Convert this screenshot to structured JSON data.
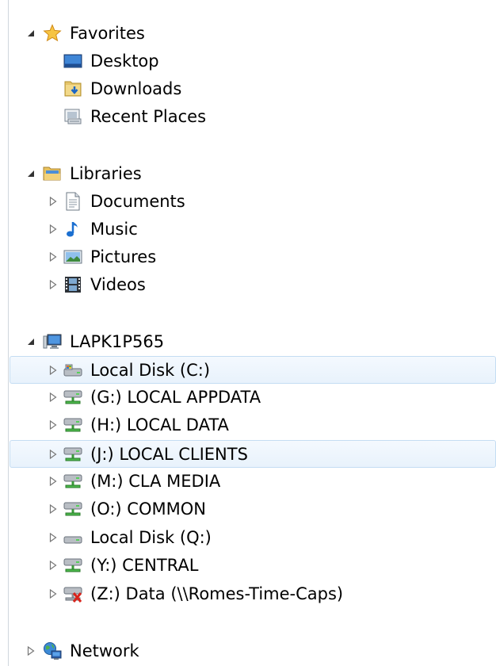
{
  "nav": {
    "favorites": {
      "label": "Favorites",
      "icon": "star-icon",
      "items": [
        {
          "label": "Desktop",
          "icon": "desktop-icon"
        },
        {
          "label": "Downloads",
          "icon": "downloads-icon"
        },
        {
          "label": "Recent Places",
          "icon": "recent-places-icon"
        }
      ]
    },
    "libraries": {
      "label": "Libraries",
      "icon": "libraries-folder-icon",
      "items": [
        {
          "label": "Documents",
          "icon": "documents-icon"
        },
        {
          "label": "Music",
          "icon": "music-note-icon"
        },
        {
          "label": "Pictures",
          "icon": "pictures-icon"
        },
        {
          "label": "Videos",
          "icon": "film-strip-icon"
        }
      ]
    },
    "computer": {
      "label": "LAPK1P565",
      "icon": "computer-icon",
      "drives": [
        {
          "label": "Local Disk (C:)",
          "icon": "system-disk-icon",
          "highlighted": true
        },
        {
          "label": "(G:) LOCAL APPDATA",
          "icon": "network-drive-icon"
        },
        {
          "label": "(H:) LOCAL DATA",
          "icon": "network-drive-icon"
        },
        {
          "label": "(J:) LOCAL CLIENTS",
          "icon": "network-drive-icon",
          "highlighted": true
        },
        {
          "label": "(M:) CLA MEDIA",
          "icon": "network-drive-icon"
        },
        {
          "label": "(O:) COMMON",
          "icon": "network-drive-icon"
        },
        {
          "label": "Local Disk (Q:)",
          "icon": "local-disk-icon"
        },
        {
          "label": "(Y:) CENTRAL",
          "icon": "network-drive-icon"
        },
        {
          "label": "(Z:) Data (\\\\Romes-Time-Caps)",
          "icon": "disconnected-drive-icon"
        }
      ]
    },
    "network": {
      "label": "Network",
      "icon": "network-globe-icon"
    }
  },
  "colors": {
    "selection_border": "#c4ddf3",
    "selection_fill": "#eaf3fc",
    "left_border": "#cfd6dd"
  }
}
